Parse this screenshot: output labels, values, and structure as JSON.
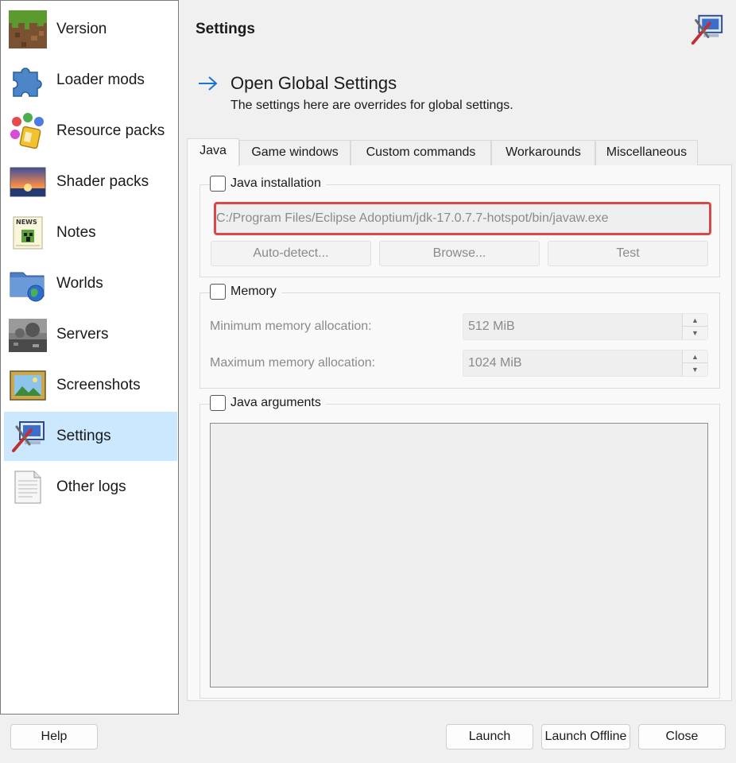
{
  "sidebar": {
    "items": [
      {
        "label": "Version",
        "icon": "grass-block-icon"
      },
      {
        "label": "Loader mods",
        "icon": "puzzle-piece-icon"
      },
      {
        "label": "Resource packs",
        "icon": "paint-bucket-icon"
      },
      {
        "label": "Shader packs",
        "icon": "sunset-icon"
      },
      {
        "label": "Notes",
        "icon": "newspaper-icon"
      },
      {
        "label": "Worlds",
        "icon": "folder-globe-icon"
      },
      {
        "label": "Servers",
        "icon": "server-landscape-icon"
      },
      {
        "label": "Screenshots",
        "icon": "framed-picture-icon"
      },
      {
        "label": "Settings",
        "icon": "settings-tools-icon",
        "selected": true
      },
      {
        "label": "Other logs",
        "icon": "document-icon"
      }
    ]
  },
  "header": {
    "title": "Settings",
    "global_link": "Open Global Settings",
    "global_subtitle": "The settings here are overrides for global settings."
  },
  "tabs": [
    {
      "label": "Java",
      "active": true
    },
    {
      "label": "Game windows"
    },
    {
      "label": "Custom commands"
    },
    {
      "label": "Workarounds"
    },
    {
      "label": "Miscellaneous"
    }
  ],
  "java_installation": {
    "title": "Java installation",
    "checked": false,
    "path": "C:/Program Files/Eclipse Adoptium/jdk-17.0.7.7-hotspot/bin/javaw.exe",
    "auto_detect": "Auto-detect...",
    "browse": "Browse...",
    "test": "Test"
  },
  "memory": {
    "title": "Memory",
    "checked": false,
    "min_label": "Minimum memory allocation:",
    "min_value": "512 MiB",
    "max_label": "Maximum memory allocation:",
    "max_value": "1024 MiB"
  },
  "java_arguments": {
    "title": "Java arguments",
    "checked": false,
    "value": ""
  },
  "footer": {
    "help": "Help",
    "launch": "Launch",
    "launch_offline": "Launch Offline",
    "close": "Close"
  },
  "colors": {
    "selected_bg": "#cce8ff",
    "highlight_border": "#d84848",
    "link_arrow": "#1a73d9"
  }
}
